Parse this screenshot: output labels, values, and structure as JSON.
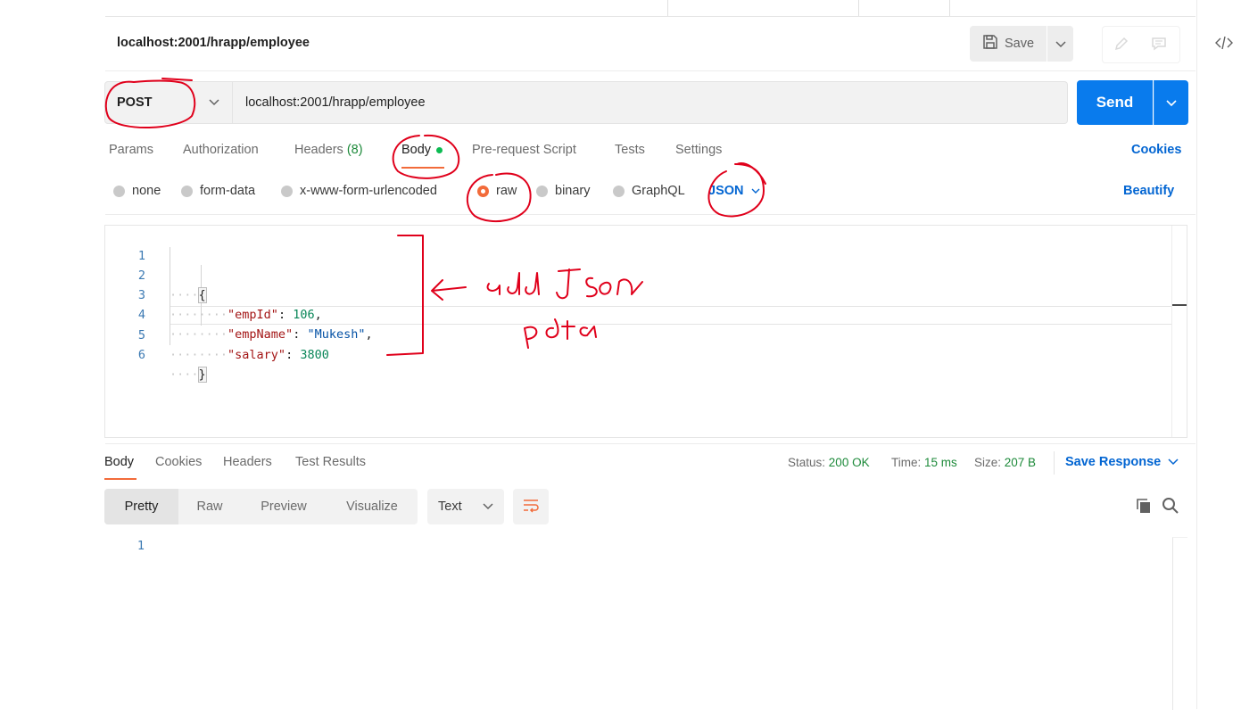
{
  "request": {
    "title": "localhost:2001/hrapp/employee",
    "save_label": "Save",
    "method": "POST",
    "url": "localhost:2001/hrapp/employee",
    "send_label": "Send"
  },
  "request_tabs": [
    {
      "label": "Params"
    },
    {
      "label": "Authorization"
    },
    {
      "label": "Headers",
      "count": "(8)"
    },
    {
      "label": "Body"
    },
    {
      "label": "Pre-request Script"
    },
    {
      "label": "Tests"
    },
    {
      "label": "Settings"
    }
  ],
  "cookies_label": "Cookies",
  "body_types": [
    {
      "label": "none",
      "selected": false
    },
    {
      "label": "form-data",
      "selected": false
    },
    {
      "label": "x-www-form-urlencoded",
      "selected": false
    },
    {
      "label": "raw",
      "selected": true
    },
    {
      "label": "binary",
      "selected": false
    },
    {
      "label": "GraphQL",
      "selected": false
    }
  ],
  "body_format": "JSON",
  "beautify_label": "Beautify",
  "editor": {
    "line_numbers": [
      "1",
      "2",
      "3",
      "4",
      "5",
      "6"
    ],
    "open_brace": "{",
    "close_brace": "}",
    "fields": [
      {
        "key": "\"empId\"",
        "sep": ": ",
        "value": "106",
        "trail": ",",
        "kind": "num"
      },
      {
        "key": "\"empName\"",
        "sep": ": ",
        "value": "\"Mukesh\"",
        "trail": ",",
        "kind": "str"
      },
      {
        "key": "\"salary\"",
        "sep": ": ",
        "value": "3800",
        "trail": "",
        "kind": "num"
      }
    ]
  },
  "response": {
    "tabs": [
      {
        "label": "Body"
      },
      {
        "label": "Cookies"
      },
      {
        "label": "Headers"
      },
      {
        "label": "Test Results"
      }
    ],
    "status_label": "Status:",
    "status_value": "200 OK",
    "time_label": "Time:",
    "time_value": "15 ms",
    "size_label": "Size:",
    "size_value": "207 B",
    "save_response_label": "Save Response",
    "view_modes": [
      {
        "label": "Pretty"
      },
      {
        "label": "Raw"
      },
      {
        "label": "Preview"
      },
      {
        "label": "Visualize"
      }
    ],
    "format_label": "Text",
    "line_numbers": [
      "1"
    ]
  },
  "colors": {
    "accent": "#f26b3a",
    "primary_blue": "#097bed",
    "link_blue": "#0265d2",
    "success_green": "#1d8a3a",
    "annotation_red": "#e0001b"
  },
  "icons": [
    "save-icon",
    "chevron-down-icon",
    "pencil-icon",
    "comment-icon",
    "code-icon",
    "wrap-lines-icon",
    "copy-icon",
    "search-icon"
  ]
}
